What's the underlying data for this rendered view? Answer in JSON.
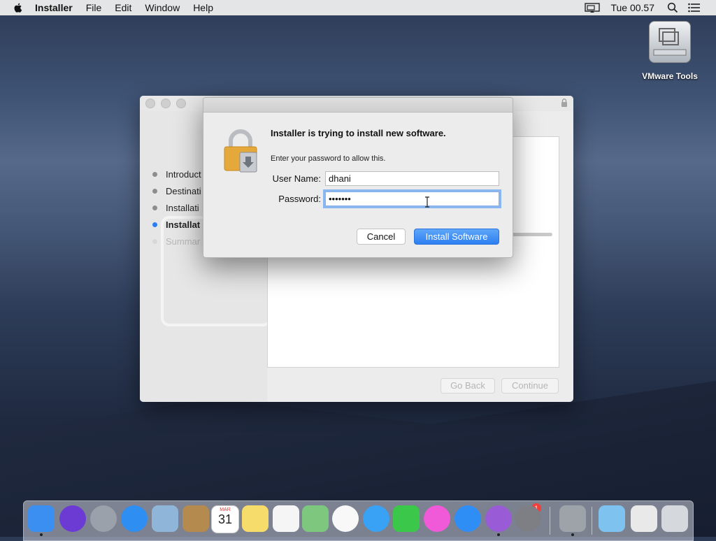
{
  "menubar": {
    "app_name": "Installer",
    "items": [
      "File",
      "Edit",
      "Window",
      "Help"
    ],
    "clock": "Tue 00.57"
  },
  "desktop": {
    "icon_label": "VMware Tools"
  },
  "installer": {
    "steps": [
      {
        "label": "Introduct",
        "state": "done"
      },
      {
        "label": "Destinati",
        "state": "done"
      },
      {
        "label": "Installati",
        "state": "done"
      },
      {
        "label": "Installat",
        "state": "active"
      },
      {
        "label": "Summar",
        "state": "pending"
      }
    ],
    "back_label": "Go Back",
    "continue_label": "Continue"
  },
  "dialog": {
    "headline": "Installer is trying to install new software.",
    "subtext": "Enter your password to allow this.",
    "username_label": "User Name:",
    "username_value": "dhani",
    "password_label": "Password:",
    "password_value": "•••••••",
    "cancel_label": "Cancel",
    "install_label": "Install Software"
  },
  "dock": {
    "items": [
      {
        "name": "finder-icon",
        "color": "#3b8ff0"
      },
      {
        "name": "siri-icon",
        "color": "#6c3bd3"
      },
      {
        "name": "launchpad-icon",
        "color": "#9aa1ab"
      },
      {
        "name": "safari-icon",
        "color": "#2e8ef2"
      },
      {
        "name": "mail-icon",
        "color": "#8fb6d9"
      },
      {
        "name": "contacts-icon",
        "color": "#b58a4e"
      },
      {
        "name": "calendar-icon",
        "color": "#ffffff"
      },
      {
        "name": "notes-icon",
        "color": "#f6dd6b"
      },
      {
        "name": "reminders-icon",
        "color": "#f5f5f5"
      },
      {
        "name": "maps-icon",
        "color": "#7dc77f"
      },
      {
        "name": "photos-icon",
        "color": "#f8f8f8"
      },
      {
        "name": "messages-icon",
        "color": "#3aa2f5"
      },
      {
        "name": "facetime-icon",
        "color": "#3bc84a"
      },
      {
        "name": "itunes-icon",
        "color": "#f05ad8"
      },
      {
        "name": "app-store-icon",
        "color": "#2f8ef5"
      },
      {
        "name": "feedback-icon",
        "color": "#9a5bd6"
      },
      {
        "name": "system-preferences-icon",
        "color": "#7d7f85"
      },
      {
        "name": "installer-icon",
        "color": "#9ea3a9"
      },
      {
        "name": "downloads-folder-icon",
        "color": "#7ec3f0"
      },
      {
        "name": "preview-icon",
        "color": "#e9e9e9"
      },
      {
        "name": "trash-icon",
        "color": "#d5d8dc"
      }
    ],
    "calendar_month": "MAR",
    "calendar_day": "31",
    "badge_count": "1"
  }
}
